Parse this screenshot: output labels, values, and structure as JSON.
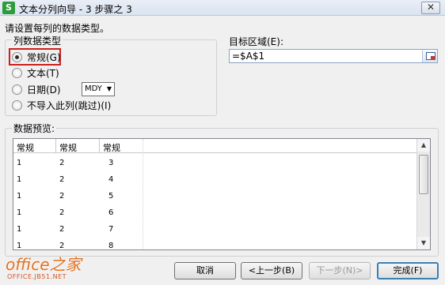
{
  "window": {
    "title": "文本分列向导 - 3 步骤之 3",
    "close_label": "✕",
    "app_icon_label": "S"
  },
  "instruction": "请设置每列的数据类型。",
  "column_type": {
    "legend": "列数据类型",
    "options": [
      {
        "label": "常规(G)",
        "checked": true
      },
      {
        "label": "文本(T)",
        "checked": false
      },
      {
        "label": "日期(D)",
        "checked": false
      },
      {
        "label": "不导入此列(跳过)(I)",
        "checked": false
      }
    ],
    "date_format": "MDY"
  },
  "destination": {
    "label": "目标区域(E):",
    "value": "=$A$1"
  },
  "preview": {
    "label": "数据预览:",
    "headers": [
      "常规",
      "常规",
      "常规"
    ],
    "rows": [
      [
        "1",
        "2",
        "3"
      ],
      [
        "1",
        "2",
        "4"
      ],
      [
        "1",
        "2",
        "5"
      ],
      [
        "1",
        "2",
        "6"
      ],
      [
        "1",
        "2",
        "7"
      ],
      [
        "1",
        "2",
        "8"
      ]
    ]
  },
  "buttons": {
    "cancel": "取消",
    "back": "<上一步(B)",
    "next": "下一步(N)>",
    "finish": "完成(F)"
  },
  "watermark": {
    "main": "office之家",
    "sub": "OFFICE.JB51.NET"
  }
}
